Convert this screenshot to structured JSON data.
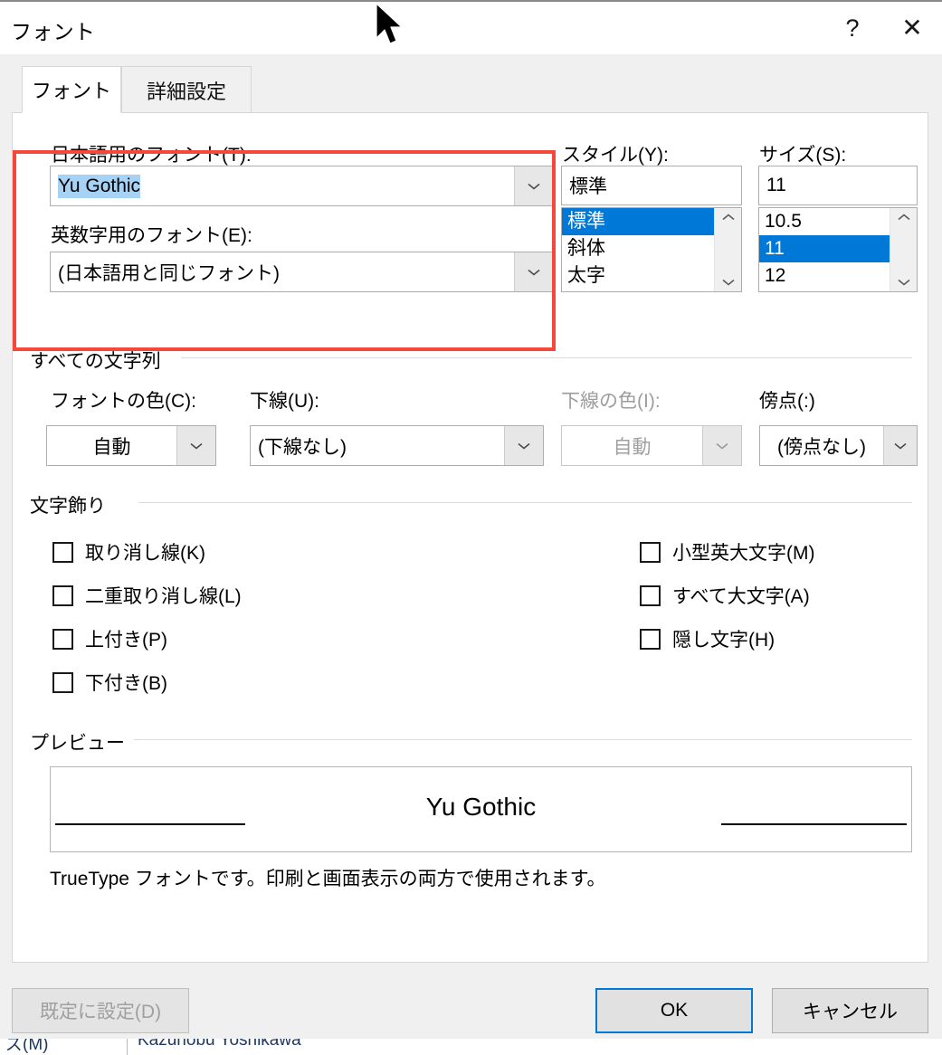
{
  "window": {
    "title": "フォント",
    "help_glyph": "?",
    "close_glyph": "✕"
  },
  "tabs": [
    {
      "label": "フォント",
      "active": true
    },
    {
      "label": "詳細設定",
      "active": false
    }
  ],
  "font_section": {
    "japanese_font": {
      "label": "日本語用のフォント(T):",
      "value": "Yu Gothic",
      "selected": true
    },
    "latin_font": {
      "label": "英数字用のフォント(E):",
      "value": "(日本語用と同じフォント)"
    },
    "style": {
      "label": "スタイル(Y):",
      "value": "標準",
      "options": [
        "標準",
        "斜体",
        "太字"
      ],
      "selected_index": 0
    },
    "size": {
      "label": "サイズ(S):",
      "value": "11",
      "options": [
        "10.5",
        "11",
        "12"
      ],
      "selected_index": 1
    }
  },
  "all_text_group": {
    "label": "すべての文字列",
    "font_color": {
      "label": "フォントの色(C):",
      "value": "自動",
      "disabled": false
    },
    "underline_style": {
      "label": "下線(U):",
      "value": "(下線なし)",
      "disabled": false
    },
    "underline_color": {
      "label": "下線の色(I):",
      "value": "自動",
      "disabled": true
    },
    "emphasis_mark": {
      "label": "傍点(:)",
      "value": "(傍点なし)",
      "disabled": false
    }
  },
  "effects_group": {
    "label": "文字飾り",
    "left_items": [
      {
        "label": "取り消し線(K)",
        "checked": false
      },
      {
        "label": "二重取り消し線(L)",
        "checked": false
      },
      {
        "label": "上付き(P)",
        "checked": false
      },
      {
        "label": "下付き(B)",
        "checked": false
      }
    ],
    "right_items": [
      {
        "label": "小型英大文字(M)",
        "checked": false
      },
      {
        "label": "すべて大文字(A)",
        "checked": false
      },
      {
        "label": "隠し文字(H)",
        "checked": false
      }
    ]
  },
  "preview_group": {
    "label": "プレビュー",
    "sample_text": "Yu Gothic",
    "caption": "TrueType フォントです。印刷と画面表示の両方で使用されます。"
  },
  "footer": {
    "set_default_label": "既定に設定(D)",
    "set_default_disabled": true,
    "ok_label": "OK",
    "cancel_label": "キャンセル"
  },
  "background_strip": {
    "left_text": "ズ(M)",
    "right_text": "Kazunobu Yoshikawa"
  },
  "colors": {
    "accent": "#0078d7",
    "selection_fill": "#a6d2f5",
    "annotation": "#f4483c",
    "dialog_bg": "#f0f0f0",
    "panel_bg": "#ffffff"
  }
}
